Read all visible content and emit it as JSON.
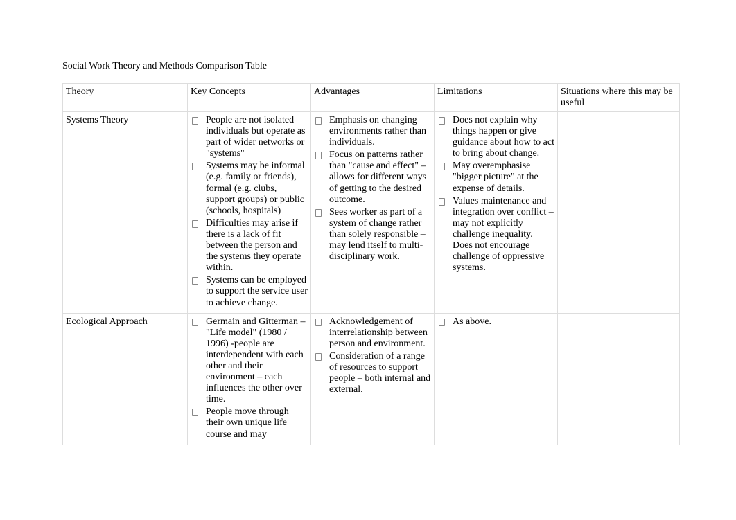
{
  "title": "Social Work Theory and Methods Comparison Table",
  "headers": {
    "theory": "Theory",
    "key": "Key Concepts",
    "adv": "Advantages",
    "lim": "Limitations",
    "sit": "Situations where this may be useful"
  },
  "rows": {
    "r0": {
      "theory": "Systems Theory",
      "key": {
        "i0": "People are not isolated individuals but operate as part of wider networks or \"systems\"",
        "i1": "Systems may be informal (e.g. family or friends), formal (e.g. clubs, support groups) or public (schools, hospitals)",
        "i2": "Difficulties may arise if there is a lack of fit between the person and the systems they operate within.",
        "i3": "Systems can be employed to support the service user to achieve change."
      },
      "adv": {
        "i0": "Emphasis on changing environments rather than individuals.",
        "i1": "Focus on patterns rather than \"cause and effect\" – allows for different ways of getting to the desired outcome.",
        "i2": "Sees worker as part of a system of change rather than solely responsible – may lend itself to multi-disciplinary work."
      },
      "lim": {
        "i0": "Does not explain why things happen or give guidance about how to act to bring about change.",
        "i1": "May overemphasise \"bigger picture\" at the expense of details.",
        "i2": "Values maintenance and integration over conflict – may not explicitly challenge inequality. Does not encourage challenge of oppressive systems."
      },
      "sit": ""
    },
    "r1": {
      "theory": "Ecological Approach",
      "key": {
        "i0": "Germain and Gitterman – \"Life model\" (1980 / 1996) -people are interdependent with each other and their environment – each influences the other over time.",
        "i1": "People move through their own unique life course and may"
      },
      "adv": {
        "i0": "Acknowledgement of interrelationship between person and environment.",
        "i1": "Consideration of a range of resources to support people – both internal and external."
      },
      "lim": {
        "i0": "As above."
      },
      "sit": ""
    }
  }
}
